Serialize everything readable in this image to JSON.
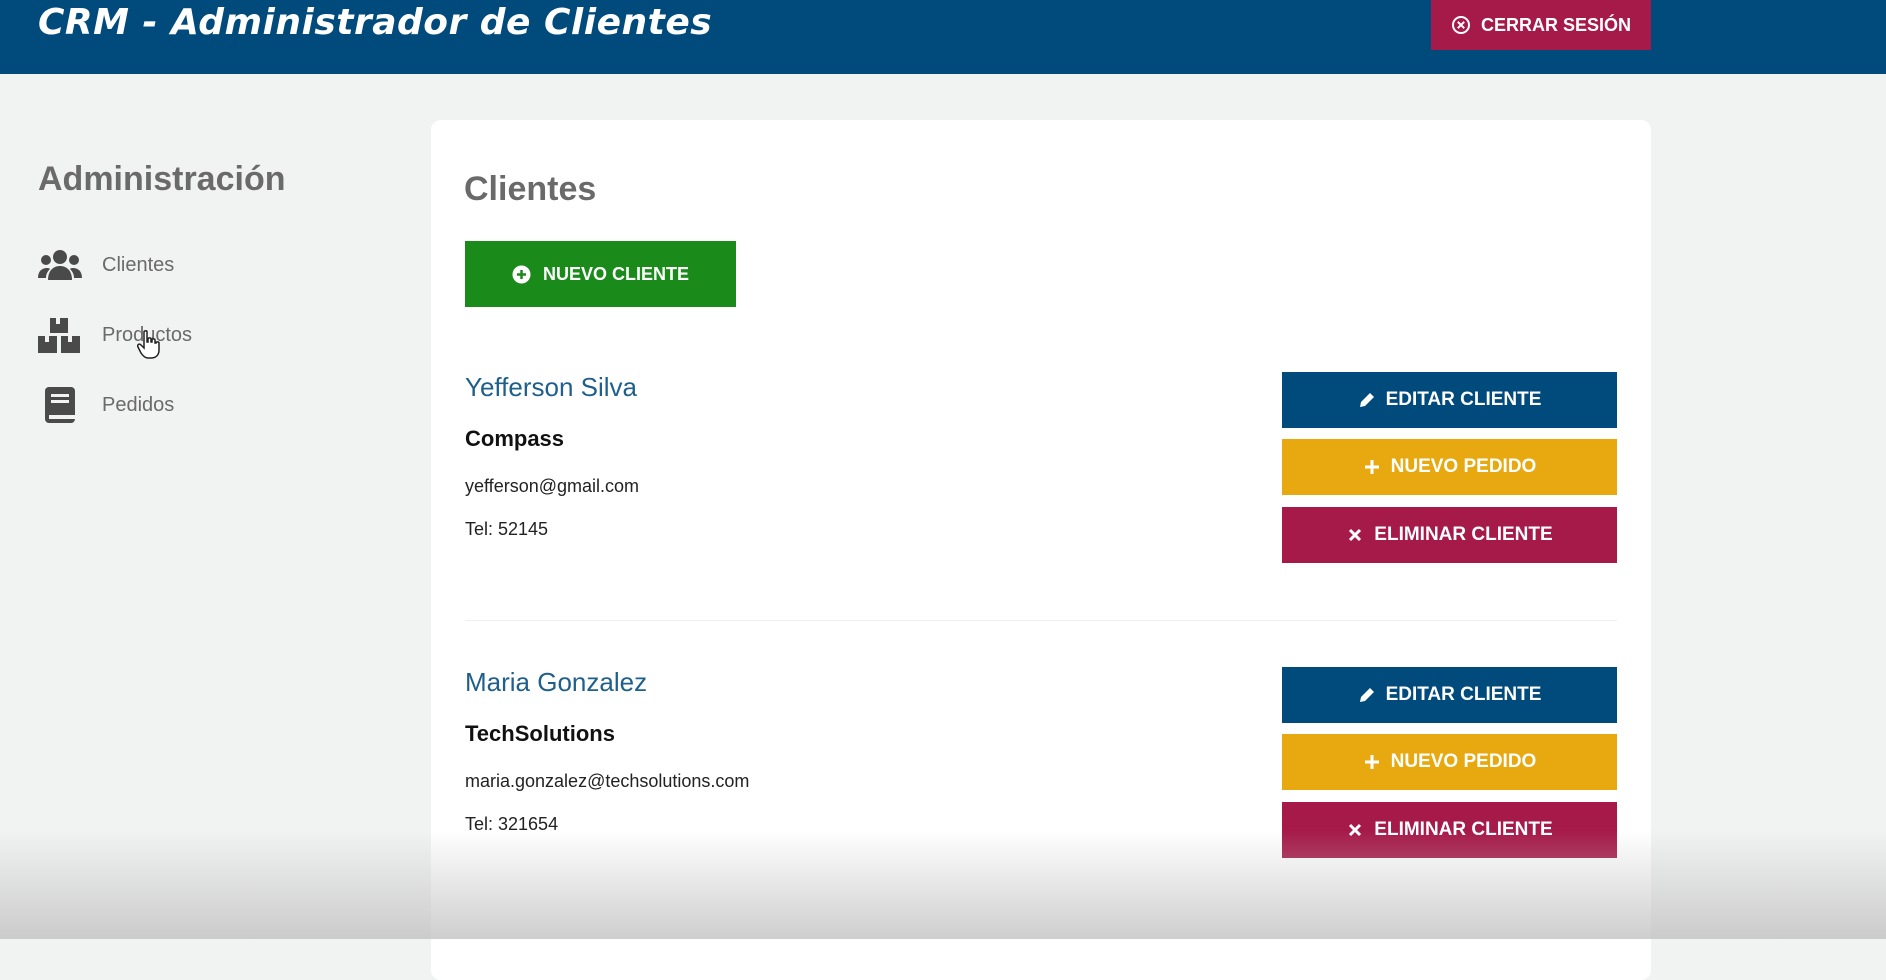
{
  "header": {
    "app_title": "CRM - Administrador de Clientes",
    "logout_label": "CERRAR SESIÓN"
  },
  "sidebar": {
    "title": "Administración",
    "items": [
      {
        "label": "Clientes",
        "icon": "users-icon"
      },
      {
        "label": "Productos",
        "icon": "boxes-icon"
      },
      {
        "label": "Pedidos",
        "icon": "book-icon"
      }
    ]
  },
  "main": {
    "title": "Clientes",
    "new_client_label": "NUEVO CLIENTE",
    "clients": [
      {
        "name": "Yefferson Silva",
        "company": "Compass",
        "email": "yefferson@gmail.com",
        "phone": "Tel: 52145"
      },
      {
        "name": "Maria Gonzalez",
        "company": "TechSolutions",
        "email": "maria.gonzalez@techsolutions.com",
        "phone": "Tel: 321654"
      }
    ],
    "actions": {
      "edit_label": "EDITAR CLIENTE",
      "new_order_label": "NUEVO PEDIDO",
      "delete_label": "ELIMINAR CLIENTE"
    }
  },
  "colors": {
    "header_bg": "#004a7c",
    "logout_bg": "#a61a4a",
    "new_client_bg": "#1a8a1a",
    "edit_bg": "#004a7c",
    "order_bg": "#e8a810",
    "delete_bg": "#a61a4a"
  }
}
